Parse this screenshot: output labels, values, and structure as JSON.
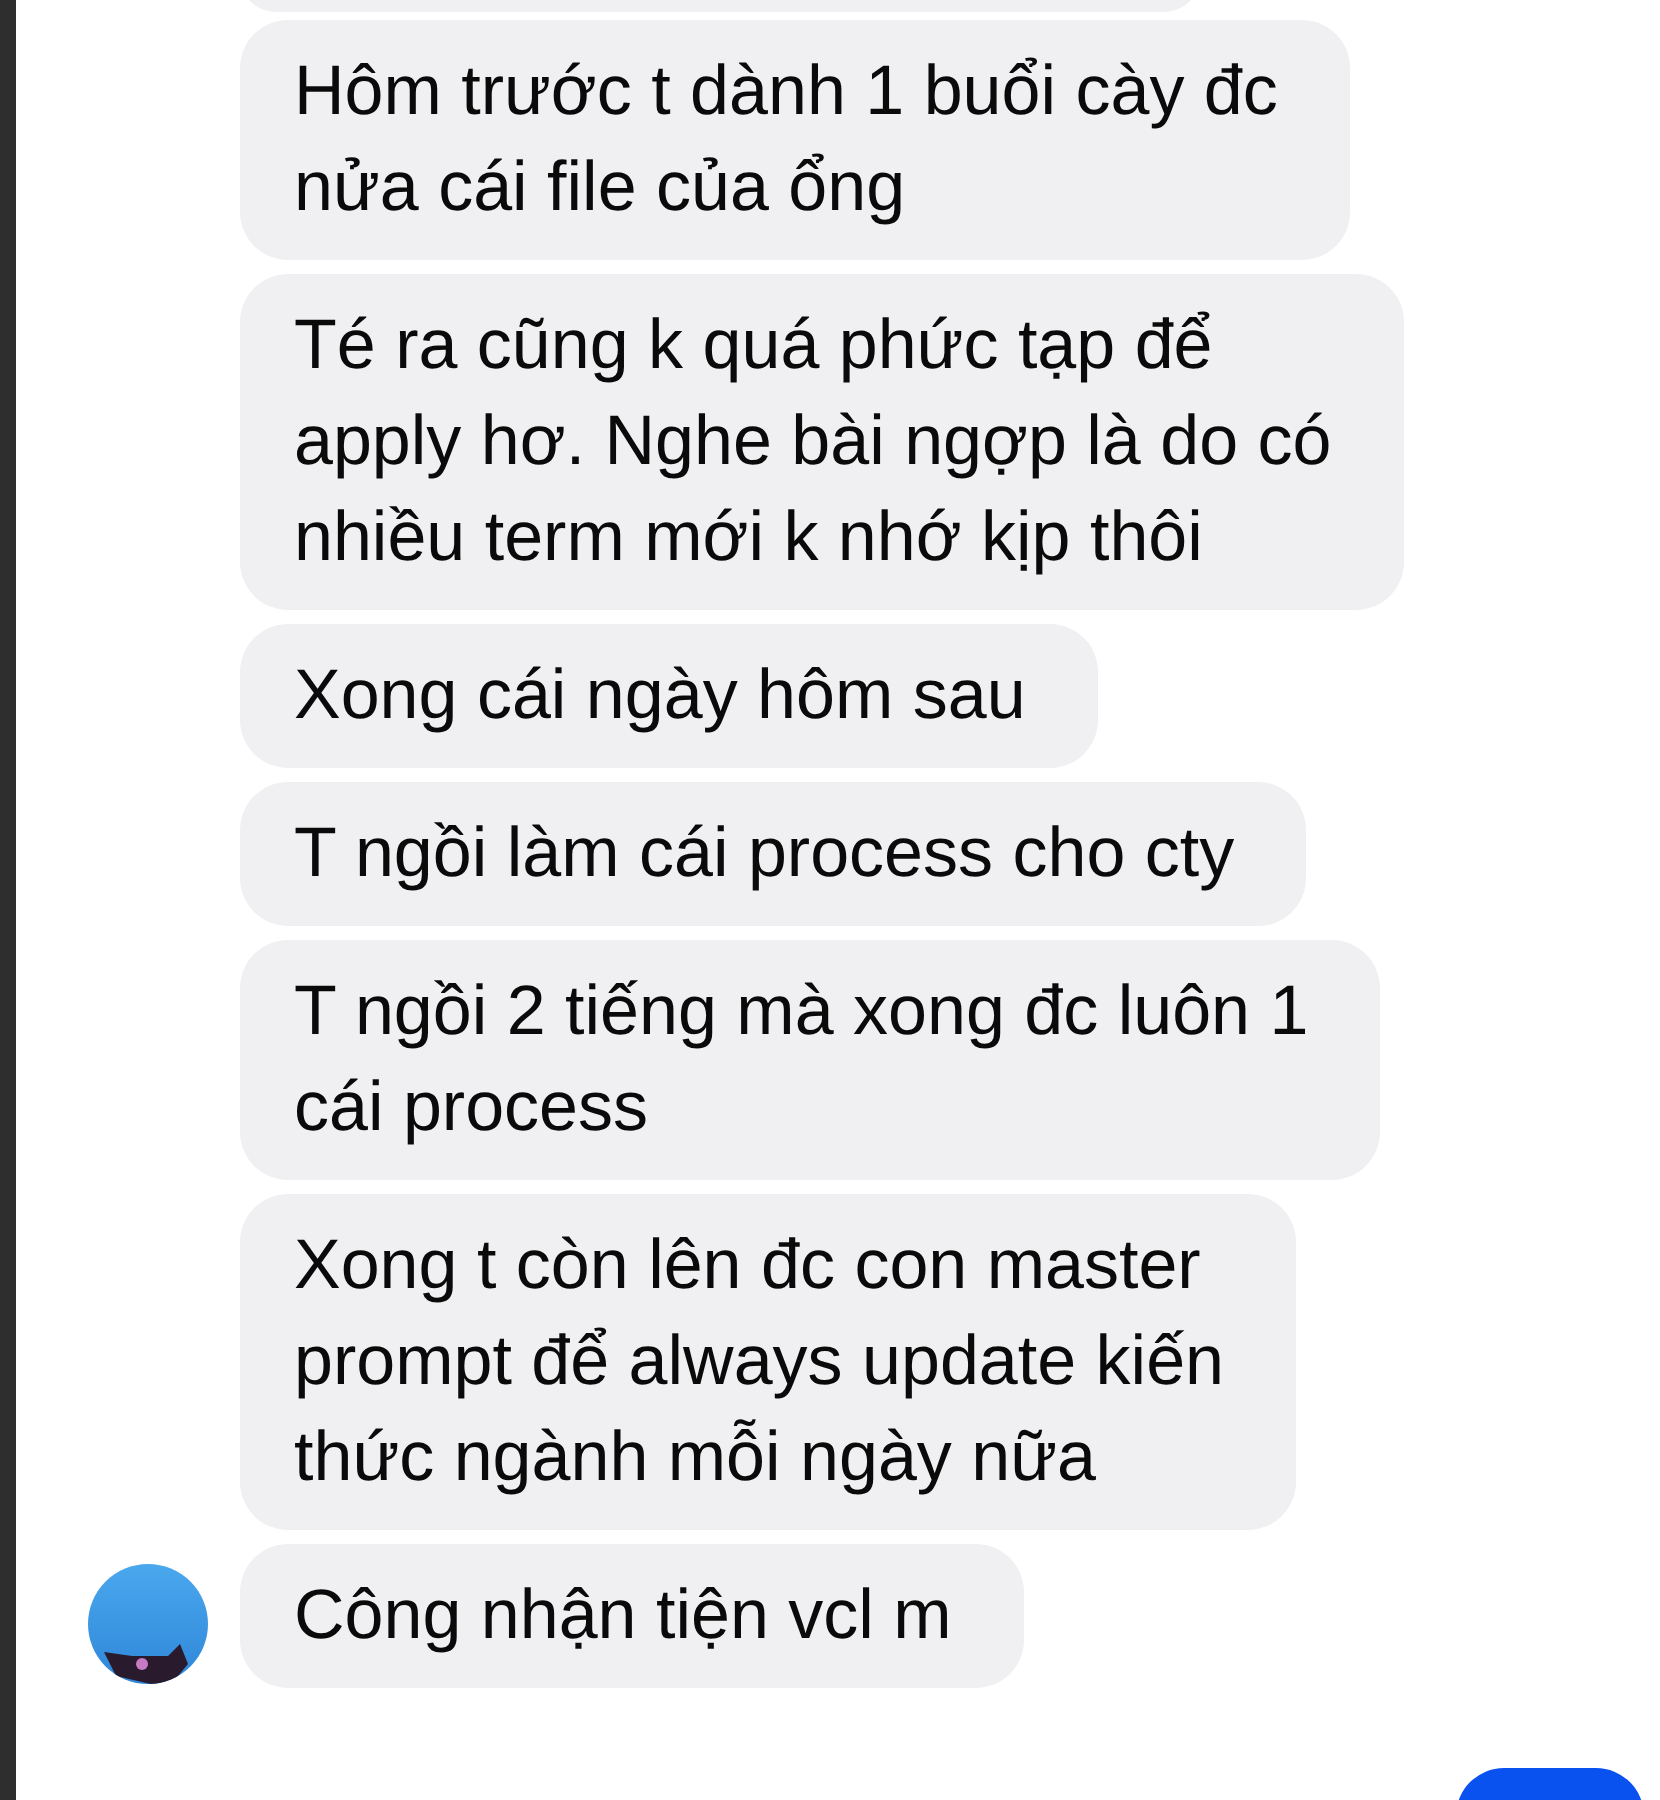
{
  "messages": [
    {
      "lines": [
        "Hôm trước t dành 1 buổi cày đc",
        "nửa cái file của ổng"
      ],
      "avatar": false
    },
    {
      "lines": [
        "Té ra cũng k quá phức tạp để",
        "apply hơ. Nghe bài ngợp là do có",
        "nhiều term mới k nhớ kịp thôi"
      ],
      "avatar": false
    },
    {
      "lines": [
        "Xong cái ngày hôm sau"
      ],
      "avatar": false
    },
    {
      "lines": [
        "T ngồi làm cái process cho cty"
      ],
      "avatar": false
    },
    {
      "lines": [
        "T ngồi 2 tiếng mà xong đc luôn 1",
        "cái process"
      ],
      "avatar": false
    },
    {
      "lines": [
        "Xong t còn lên đc con master",
        "prompt để always update kiến",
        "thức ngành mỗi ngày nữa"
      ],
      "avatar": false
    },
    {
      "lines": [
        "Công nhận tiện vcl m"
      ],
      "avatar": true
    }
  ]
}
